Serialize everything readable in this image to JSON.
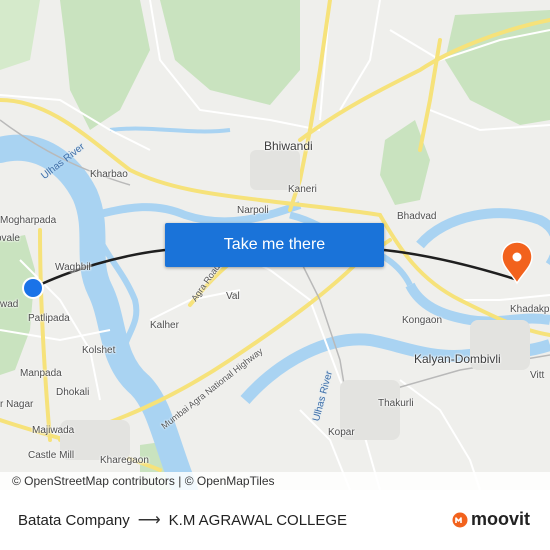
{
  "map": {
    "places": {
      "bhiwandi": "Bhiwandi",
      "kharbao": "Kharbao",
      "kaneri": "Kaneri",
      "narpoli": "Narpoli",
      "bhadvad": "Bhadvad",
      "mogharpada": "Mogharpada",
      "vale": "ovale",
      "waghbil": "Waghbil",
      "wad": "wad",
      "patlipada": "Patlipada",
      "kolshet": "Kolshet",
      "manpada": "Manpada",
      "dhokali": "Dhokali",
      "nagar": "r Nagar",
      "majiwada": "Majiwada",
      "castle_mill": "Castle Mill",
      "kharegaon": "Kharegaon",
      "kalher": "Kalher",
      "val": "Val",
      "kongaon": "Kongaon",
      "kalyan_dombivli": "Kalyan-Dombivli",
      "khadakpada": "Khadakpada",
      "vitt": "Vitt",
      "thakurli": "Thakurli",
      "kopar": "Kopar"
    },
    "rivers": {
      "ulhas_river_west": "Ulhas River",
      "ulhas_river_south": "Ulhas River"
    },
    "roads": {
      "agra_road": "Agra Road",
      "mumbai_agra_highway": "Mumbai Agra National Highway"
    },
    "colors": {
      "water": "#a9d3f2",
      "green": "#c9e3bf",
      "road_major": "#f6e27a",
      "route": "#1f1f1f",
      "origin": "#1a73e8",
      "destination": "#f2621d"
    },
    "icons": {
      "origin": "origin-dot-icon",
      "destination": "destination-pin-icon"
    }
  },
  "cta": {
    "label": "Take me there"
  },
  "attribution": {
    "osm": "© OpenStreetMap contributors",
    "separator": "|",
    "omt": "© OpenMapTiles"
  },
  "footer": {
    "origin": "Batata Company",
    "arrow": "⟶",
    "destination": "K.M AGRAWAL COLLEGE",
    "brand": "moovit"
  }
}
